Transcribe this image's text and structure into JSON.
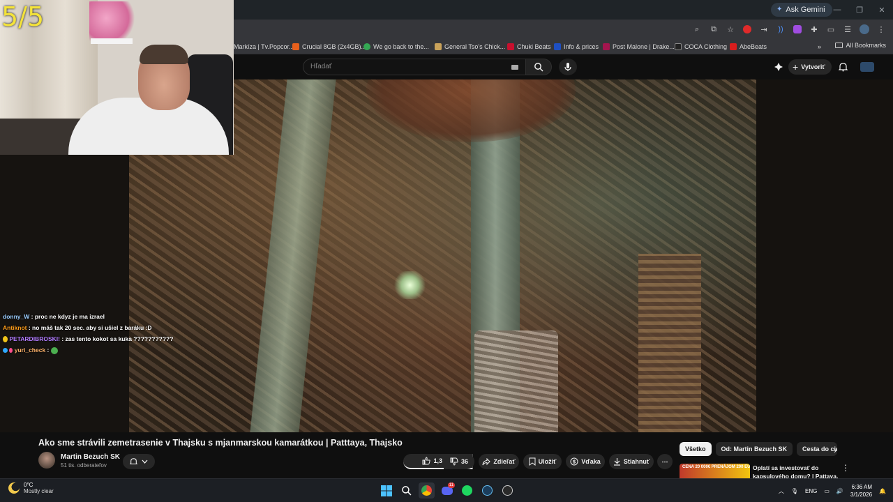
{
  "browser": {
    "ask_gemini": "Ask Gemini",
    "bookmarks": [
      {
        "label": "Markíza | Tv.Popcor...",
        "color": "#000000"
      },
      {
        "label": "Crucial 8GB (2x4GB)...",
        "color": "#e8601c"
      },
      {
        "label": "We go back to the...",
        "color": "#34a853"
      },
      {
        "label": "General Tso's Chick...",
        "color": "#c9a25a"
      },
      {
        "label": "Chuki Beats",
        "color": "#c8102e"
      },
      {
        "label": "Info & prices",
        "color": "#1e4fc2"
      },
      {
        "label": "Post Malone | Drake...",
        "color": "#a3154e"
      },
      {
        "label": "COCA Clothing",
        "color": "#222222"
      },
      {
        "label": "AbeBeats",
        "color": "#d91d1d"
      }
    ],
    "all_bookmarks": "All Bookmarks"
  },
  "youtube": {
    "search_placeholder": "Hľadať",
    "create_label": "Vytvoriť",
    "video_title": "Ako sme strávili zemetrasenie v Thajsku s mjanmarskou kamarátkou | Patttaya, Thajsko",
    "channel_name": "Martin Bezuch SK",
    "channel_subs": "51 tis. odberateľov",
    "likes": "1,3 tis.",
    "dislikes": "36",
    "share_label": "Zdieľať",
    "save_label": "Uložiť",
    "thanks_label": "Vďaka",
    "download_label": "Stiahnuť",
    "chips": [
      "Všetko",
      "Od: Martin Bezuch SK",
      "Cesta do cieľa"
    ],
    "reco_title": "Oplatí sa investovať do kapsulového domu? | Pattaya, ...",
    "reco_thumb_text": "CENA 20 000€ PRENÁJOM 200 EUR"
  },
  "stream": {
    "counter": "5/5",
    "chat": [
      {
        "user": "donny_W",
        "user_color": "#9acdff",
        "text": ": proc ne kdyz je ma izrael",
        "badges": []
      },
      {
        "user": "Antiknot",
        "user_color": "#ff9d1a",
        "text": ": no máš tak 20 sec. aby si ušiel z baráku :D",
        "badges": []
      },
      {
        "user": "PETARDIBROSKI!",
        "user_color": "#b27cff",
        "text": ": zas tento kokot sa kuka ???????????",
        "badges": [
          "#f0c419"
        ]
      },
      {
        "user": "yuri_check",
        "user_color": "#ffb36b",
        "text": ":",
        "badges": [
          "#2fa8ff",
          "#ff4d8d"
        ],
        "emote": "#4caf50"
      }
    ]
  },
  "taskbar": {
    "temperature": "0°C",
    "weather": "Mostly clear",
    "language": "ENG",
    "time": "6:36 AM",
    "date": "3/1/2026",
    "discord_badge": "11"
  }
}
